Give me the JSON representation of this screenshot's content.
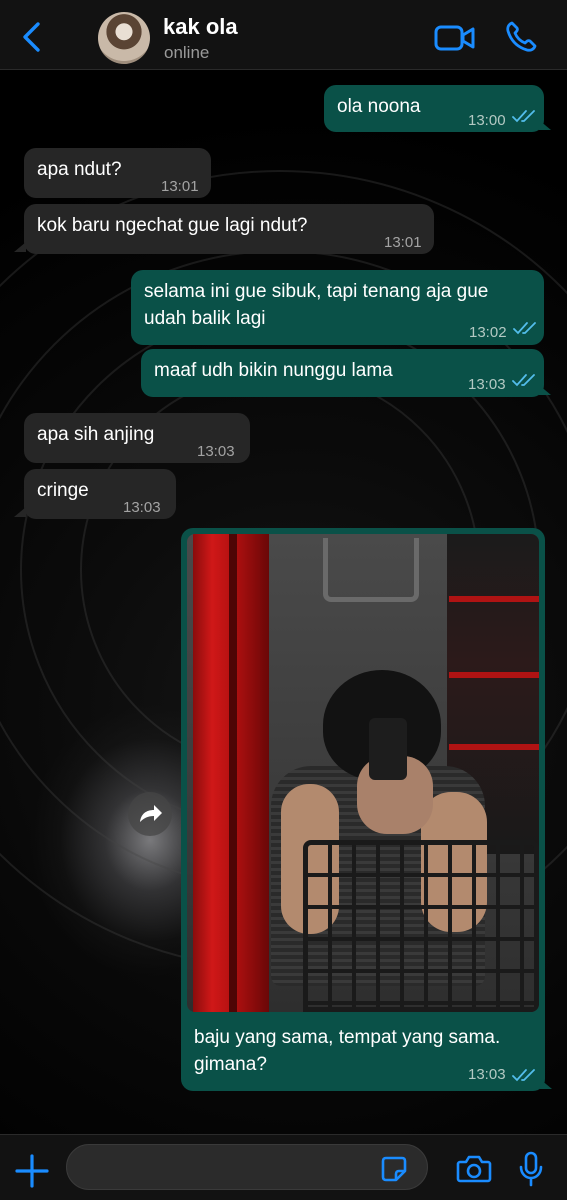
{
  "header": {
    "contact_name": "kak ola",
    "status": "online"
  },
  "messages": [
    {
      "dir": "out",
      "text": "ola noona",
      "time": "13:00",
      "read": true
    },
    {
      "dir": "in",
      "text": "apa ndut?",
      "time": "13:01"
    },
    {
      "dir": "in",
      "text": "kok baru ngechat gue lagi ndut?",
      "time": "13:01"
    },
    {
      "dir": "out",
      "text": "selama ini gue sibuk, tapi tenang aja gue udah balik lagi",
      "time": "13:02",
      "read": true
    },
    {
      "dir": "out",
      "text": "maaf udh bikin nunggu lama",
      "time": "13:03",
      "read": true
    },
    {
      "dir": "in",
      "text": "apa sih anjing",
      "time": "13:03"
    },
    {
      "dir": "in",
      "text": "cringe",
      "time": "13:03"
    },
    {
      "dir": "out",
      "type": "photo",
      "text": "baju yang sama, tempat yang sama. gimana?",
      "time": "13:03",
      "read": true
    }
  ],
  "composer": {
    "value": "",
    "placeholder": ""
  },
  "colors": {
    "accent": "#1a8cff",
    "outgoing_bubble": "#0a5148",
    "incoming_bubble": "#262626",
    "read_ticks": "#53bdeb"
  }
}
